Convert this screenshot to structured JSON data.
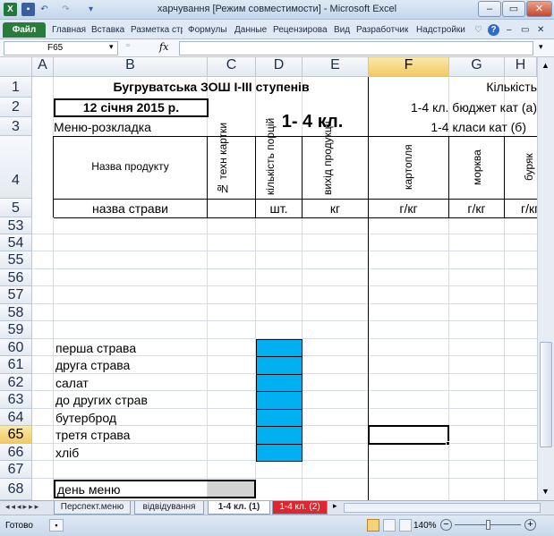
{
  "window": {
    "title": "харчування  [Режим совместимости] - Microsoft Excel",
    "minimize": "–",
    "maximize": "▭",
    "close": "✕"
  },
  "ribbon": {
    "tabs": [
      "Файл",
      "Главная",
      "Вставка",
      "Разметка стр",
      "Формулы",
      "Данные",
      "Рецензирова",
      "Вид",
      "Разработчик",
      "Надстройки"
    ]
  },
  "formula_bar": {
    "name_box": "F65",
    "fx": "fx",
    "value": ""
  },
  "columns": [
    "A",
    "B",
    "C",
    "D",
    "E",
    "F",
    "G",
    "H"
  ],
  "rows": [
    "1",
    "2",
    "3",
    "4",
    "5",
    "53",
    "54",
    "55",
    "56",
    "57",
    "58",
    "59",
    "60",
    "61",
    "62",
    "63",
    "64",
    "65",
    "66",
    "67",
    "68"
  ],
  "cells": {
    "school_title": "Бугруватська ЗОШ І-ІІІ ступенів",
    "kilkist": "Кількість",
    "date": "12 січня 2015 р.",
    "budget_a": "1-4 кл. бюджет кат (а)",
    "class_label": "1- 4 кл.",
    "menu_layout": "Меню-розкладка",
    "classes_b": "1-4 класи кат (б)",
    "product_name": "Назва продукту",
    "card_no": "№ техн картки",
    "portions": "кількість порцій",
    "output": "вихід продукції",
    "potato": "картопля",
    "carrot": "морква",
    "beet": "буряк",
    "dish_name": "назва страви",
    "unit_pcs": "шт.",
    "unit_kg": "кг",
    "unit_gkg_f": "г/кг",
    "unit_gkg_g": "г/кг",
    "unit_gkg_h": "г/кг",
    "first_course": "перша страва",
    "second_course": "друга страва",
    "salad": "салат",
    "side_dish": "до других страв",
    "sandwich": "бутерброд",
    "third_course": "третя страва",
    "bread": "хліб",
    "menu_day": "день меню"
  },
  "sheets": [
    "Перспект.меню",
    "відвідування",
    "1-4 кл. (1)",
    "1-4 кл. (2)"
  ],
  "status": {
    "ready": "Готово",
    "zoom": "140%"
  },
  "colors": {
    "highlight_blue": "#00b0f0",
    "active_header": "#f1c963",
    "excel_green": "#2a7a3a"
  }
}
